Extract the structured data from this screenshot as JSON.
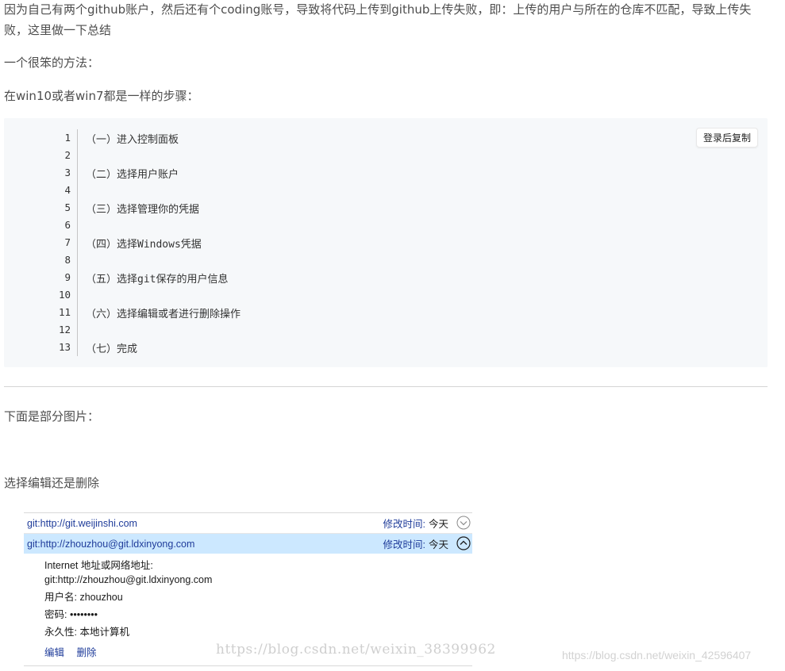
{
  "intro": {
    "line1": "因为自己有两个github账户，然后还有个coding账号，导致将代码上传到github上传失败，即：上传的用户与所在的仓库不匹配，导致上传失败，这里做一下总结",
    "line2": "一个很笨的方法：",
    "line3": "在win10或者win7都是一样的步骤："
  },
  "code": {
    "copy_label": "登录后复制",
    "lines": [
      {
        "no": "1",
        "text": "（一）进入控制面板"
      },
      {
        "no": "2",
        "text": ""
      },
      {
        "no": "3",
        "text": "（二）选择用户账户"
      },
      {
        "no": "4",
        "text": ""
      },
      {
        "no": "5",
        "text": "（三）选择管理你的凭据"
      },
      {
        "no": "6",
        "text": ""
      },
      {
        "no": "7",
        "text": "（四）选择Windows凭据"
      },
      {
        "no": "8",
        "text": ""
      },
      {
        "no": "9",
        "text": "（五）选择git保存的用户信息"
      },
      {
        "no": "10",
        "text": ""
      },
      {
        "no": "11",
        "text": "（六）选择编辑或者进行删除操作"
      },
      {
        "no": "12",
        "text": ""
      },
      {
        "no": "13",
        "text": "（七）完成"
      }
    ]
  },
  "after": {
    "images_note": "下面是部分图片：",
    "select_note": "选择编辑还是删除"
  },
  "credentials": {
    "rows": [
      {
        "name": "git:http://git.weijinshi.com",
        "modified_label": "修改时间:",
        "modified_value": "今天",
        "icon": "chevron-down-icon"
      },
      {
        "name": "git:http://zhouzhou@git.ldxinyong.com",
        "modified_label": "修改时间:",
        "modified_value": "今天",
        "icon": "chevron-up-icon"
      }
    ],
    "detail": {
      "address_label": "Internet 地址或网络地址:",
      "address_value": "git:http://zhouzhou@git.ldxinyong.com",
      "username_label": "用户名:",
      "username_value": "zhouzhou",
      "password_label": "密码:",
      "password_value": "••••••••",
      "persistence_label": "永久性:",
      "persistence_value": "本地计算机",
      "edit_label": "编辑",
      "delete_label": "删除"
    }
  },
  "watermarks": {
    "first": "https://blog.csdn.net/weixin_38399962",
    "second": "https://blog.csdn.net/weixin_42596407"
  },
  "colors": {
    "link_blue": "#1f3c9a",
    "selected_row": "#cce8ff",
    "code_bg": "#f6f8fa"
  }
}
